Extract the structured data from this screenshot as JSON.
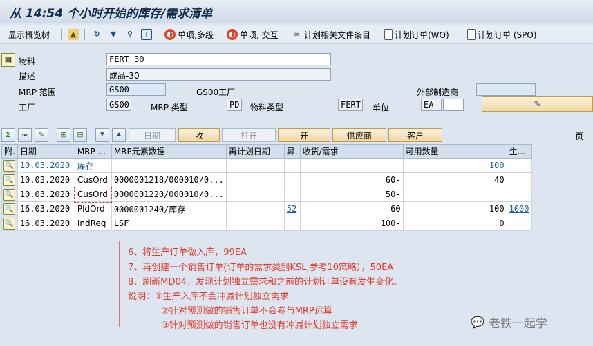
{
  "title": "从 14:54 个小时开始的库存/需求清单",
  "toolbar": {
    "overview_tree": "显示概览树",
    "single_multi": "单项,多级",
    "single_interactive": "单项, 交互",
    "planning_file_entry": "计划相关文件条目",
    "planned_order_wo": "计划订单(WO)",
    "planned_order_spo": "计划订单 (SPO)"
  },
  "header": {
    "material_label": "物料",
    "material_value": "FERT 30",
    "description_label": "描述",
    "description_value": "成品-30",
    "mrp_area_label": "MRP 范围",
    "mrp_area_value": "GS00",
    "mrp_area_plant_label": "GS00工厂",
    "external_mfr_label": "外部制造商",
    "plant_label": "工厂",
    "plant_value": "GS00",
    "mrp_type_label": "MRP 类型",
    "mrp_type_value": "PD",
    "material_type_label": "物料类型",
    "material_type_value": "FERT",
    "unit_label": "单位",
    "unit_value": "EA"
  },
  "buttons": {
    "date": "日期",
    "receipts": "收",
    "open": "打开",
    "open2": "开",
    "vendor": "供应商",
    "customer": "客户",
    "page": "页"
  },
  "columns": [
    "附.",
    "日期",
    "MRP ...",
    "MRP元素数据",
    "再计划日期",
    "异.",
    "收货/需求",
    "可用数量",
    "生..."
  ],
  "rows": [
    {
      "date": "10.03.2020",
      "element": "库存",
      "data": "",
      "resched": "",
      "exc": "",
      "qty": "",
      "avail": "100",
      "prod": ""
    },
    {
      "date": "10.03.2020",
      "element": "CusOrd",
      "data": "0000001218/000010/0...",
      "resched": "",
      "exc": "",
      "qty": "60-",
      "avail": "40",
      "prod": ""
    },
    {
      "date": "10.03.2020",
      "element": "CusOrd",
      "data": "0000001220/000010/0...",
      "resched": "",
      "exc": "",
      "qty": "50-",
      "avail": "",
      "prod": ""
    },
    {
      "date": "16.03.2020",
      "element": "PldOrd",
      "data": "0000001240/库存",
      "resched": "",
      "exc": "52",
      "qty": "60",
      "avail": "100",
      "prod": "1000"
    },
    {
      "date": "16.03.2020",
      "element": "IndReq",
      "data": "LSF",
      "resched": "",
      "exc": "",
      "qty": "100-",
      "avail": "0",
      "prod": ""
    }
  ],
  "notes": [
    "6、将生产订单做入库，99EA",
    "7、再创建一个销售订单(订单的需求类别KSL,参考10策略），50EA",
    "8、刷新MD04，发现计划独立需求和之前的计划订单没有发生变化。",
    "说明：①生产入库不会冲减计划独立需求",
    "②针对预测做的销售订单不会参与MRP运算",
    "③针对预测做的销售订单也没有冲减计划独立需求"
  ],
  "watermark": "老铁一起学"
}
